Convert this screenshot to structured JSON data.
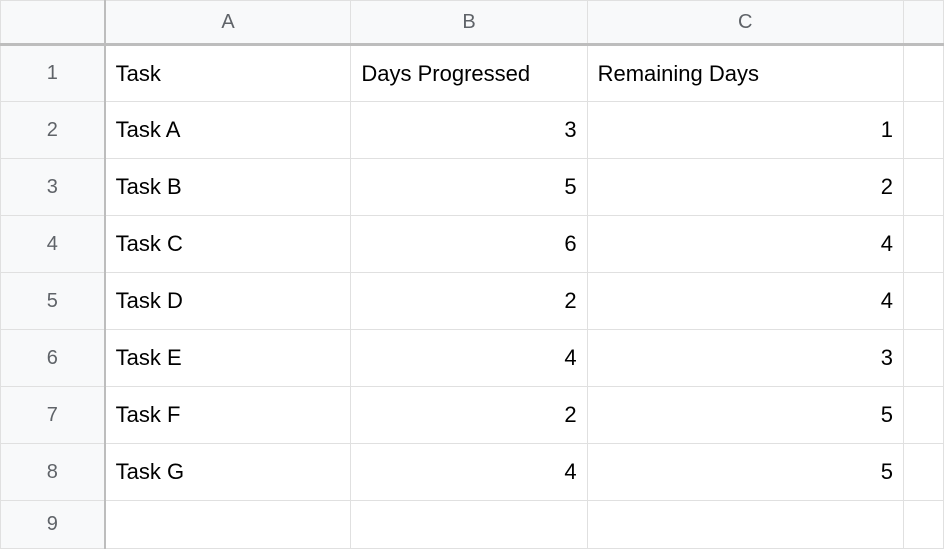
{
  "columns": {
    "a": "A",
    "b": "B",
    "c": "C"
  },
  "rowNumbers": {
    "r1": "1",
    "r2": "2",
    "r3": "3",
    "r4": "4",
    "r5": "5",
    "r6": "6",
    "r7": "7",
    "r8": "8",
    "r9": "9"
  },
  "headers": {
    "task": "Task",
    "daysProgressed": "Days Progressed",
    "remainingDays": "Remaining Days"
  },
  "rows": [
    {
      "task": "Task A",
      "daysProgressed": "3",
      "remainingDays": "1"
    },
    {
      "task": "Task B",
      "daysProgressed": "5",
      "remainingDays": "2"
    },
    {
      "task": "Task C",
      "daysProgressed": "6",
      "remainingDays": "4"
    },
    {
      "task": "Task D",
      "daysProgressed": "2",
      "remainingDays": "4"
    },
    {
      "task": "Task E",
      "daysProgressed": "4",
      "remainingDays": "3"
    },
    {
      "task": "Task F",
      "daysProgressed": "2",
      "remainingDays": "5"
    },
    {
      "task": "Task G",
      "daysProgressed": "4",
      "remainingDays": "5"
    }
  ],
  "chart_data": {
    "type": "table",
    "title": "",
    "columns": [
      "Task",
      "Days Progressed",
      "Remaining Days"
    ],
    "rows": [
      [
        "Task A",
        3,
        1
      ],
      [
        "Task B",
        5,
        2
      ],
      [
        "Task C",
        6,
        4
      ],
      [
        "Task D",
        2,
        4
      ],
      [
        "Task E",
        4,
        3
      ],
      [
        "Task F",
        2,
        5
      ],
      [
        "Task G",
        4,
        5
      ]
    ]
  }
}
